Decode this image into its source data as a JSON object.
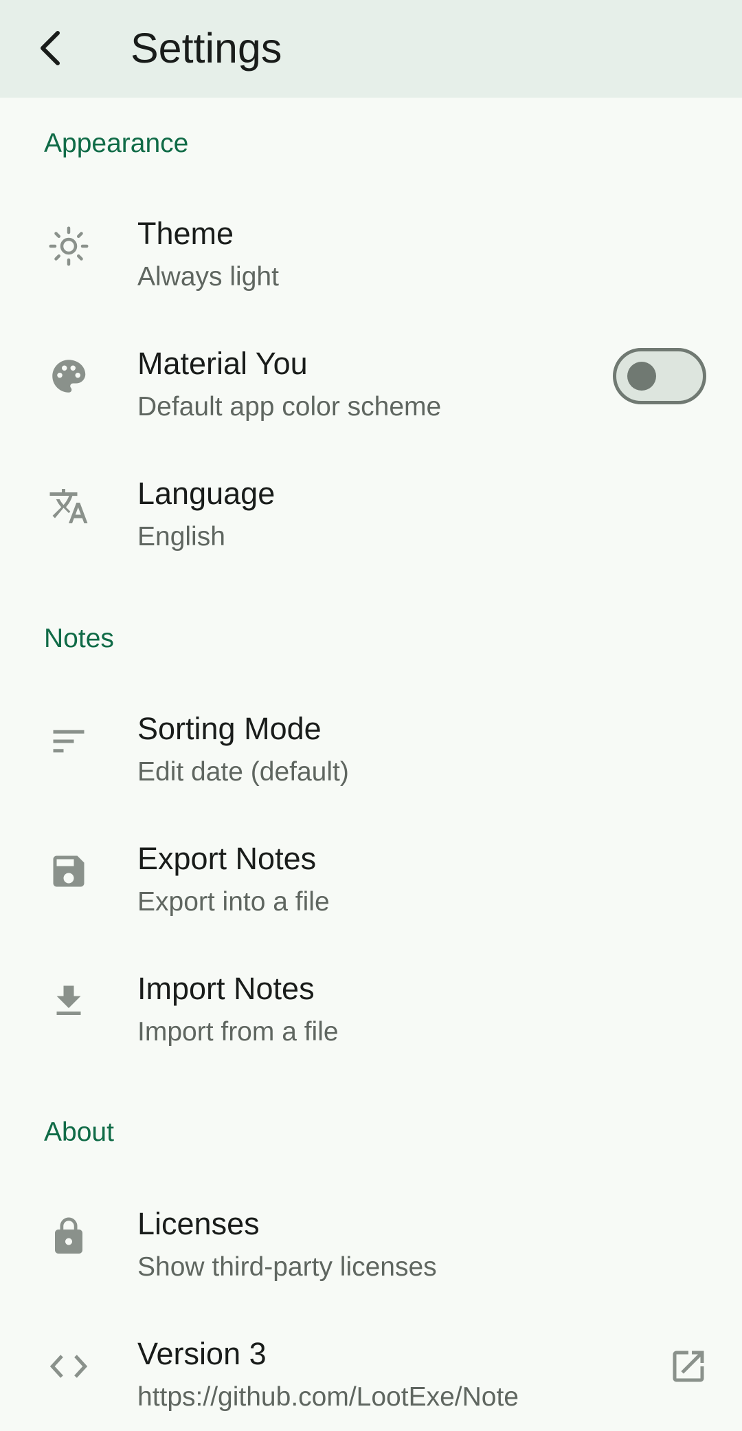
{
  "app_bar": {
    "title": "Settings",
    "back_icon": "arrow-back-icon"
  },
  "sections": {
    "appearance": {
      "header": "Appearance"
    },
    "notes": {
      "header": "Notes"
    },
    "about": {
      "header": "About"
    }
  },
  "items": {
    "theme": {
      "title": "Theme",
      "subtitle": "Always light",
      "icon": "brightness-icon"
    },
    "material_you": {
      "title": "Material You",
      "subtitle": "Default app color scheme",
      "icon": "palette-icon",
      "toggle_on": false
    },
    "language": {
      "title": "Language",
      "subtitle": "English",
      "icon": "translate-icon"
    },
    "sorting": {
      "title": "Sorting Mode",
      "subtitle": "Edit date (default)",
      "icon": "sort-icon"
    },
    "export": {
      "title": "Export Notes",
      "subtitle": "Export into a file",
      "icon": "save-icon"
    },
    "import": {
      "title": "Import Notes",
      "subtitle": "Import from a file",
      "icon": "download-icon"
    },
    "licenses": {
      "title": "Licenses",
      "subtitle": "Show third-party licenses",
      "icon": "lock-icon"
    },
    "version": {
      "title": "Version 3",
      "subtitle": "https://github.com/LootExe/Note",
      "icon": "code-icon",
      "trailing_icon": "open-in-new-icon"
    }
  },
  "colors": {
    "accent": "#106b47",
    "app_bar": "#e6efe9",
    "background": "#f7faf6",
    "icon": "#8a918b"
  }
}
